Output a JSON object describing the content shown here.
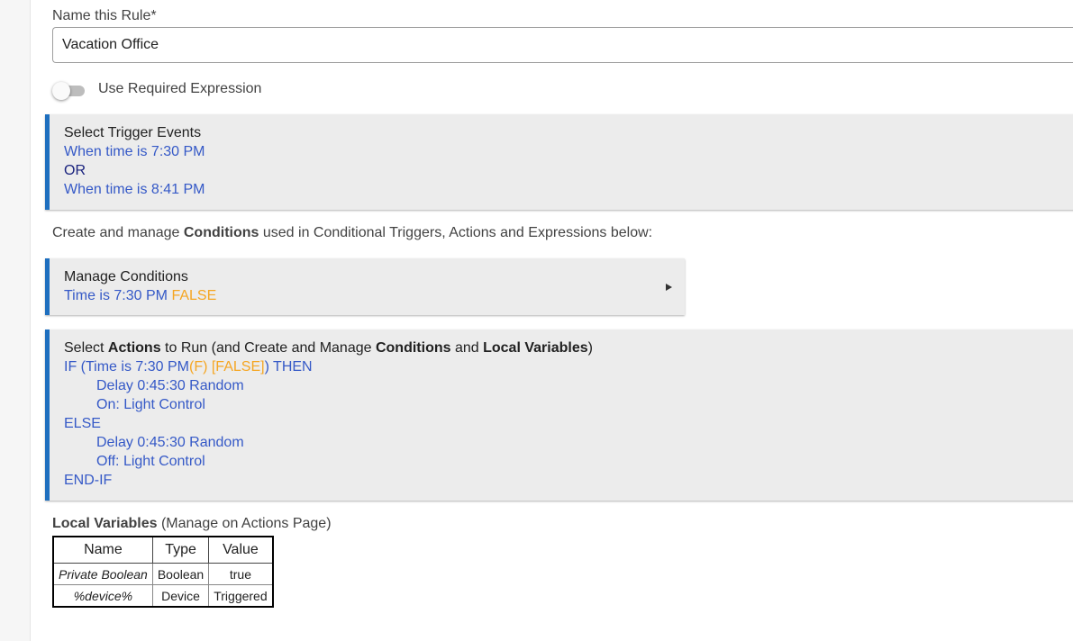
{
  "rule_name": {
    "label": "Name this Rule*",
    "value": "Vacation Office"
  },
  "required_expression": {
    "label": "Use Required Expression",
    "enabled": false
  },
  "trigger_events": {
    "title": "Select Trigger Events",
    "events": [
      "When time is 7:30 PM",
      "When time is 8:41 PM"
    ],
    "separator": "OR"
  },
  "conditions_intro": {
    "prefix": "Create and manage ",
    "bold": "Conditions",
    "suffix": " used in Conditional Triggers, Actions and Expressions below:"
  },
  "manage_conditions": {
    "title": "Manage Conditions",
    "condition": "Time is 7:30 PM",
    "state": "FALSE",
    "expand_icon": "triangle-right-icon"
  },
  "actions": {
    "title_parts": [
      "Select ",
      "Actions",
      " to Run (and Create and Manage ",
      "Conditions",
      " and ",
      "Local Variables",
      ")"
    ],
    "if_open": "IF (Time is 7:30 PM",
    "if_flag": "(F) [FALSE]",
    "if_close": ") THEN",
    "then_lines": [
      "Delay 0:45:30 Random",
      "On: Light Control"
    ],
    "else": "ELSE",
    "else_lines": [
      "Delay 0:45:30 Random",
      "Off: Light Control"
    ],
    "end": "END-IF"
  },
  "local_variables": {
    "heading_bold": "Local Variables",
    "heading_rest": " (Manage on Actions Page)",
    "columns": [
      "Name",
      "Type",
      "Value"
    ],
    "rows": [
      {
        "name": "Private Boolean",
        "type": "Boolean",
        "value": "true"
      },
      {
        "name": "%device%",
        "type": "Device",
        "value": "Triggered"
      }
    ]
  },
  "colors": {
    "accent": "#1e6fbf",
    "link": "#3559c7",
    "false_state": "#f5a623",
    "or_text": "#1a237e"
  }
}
